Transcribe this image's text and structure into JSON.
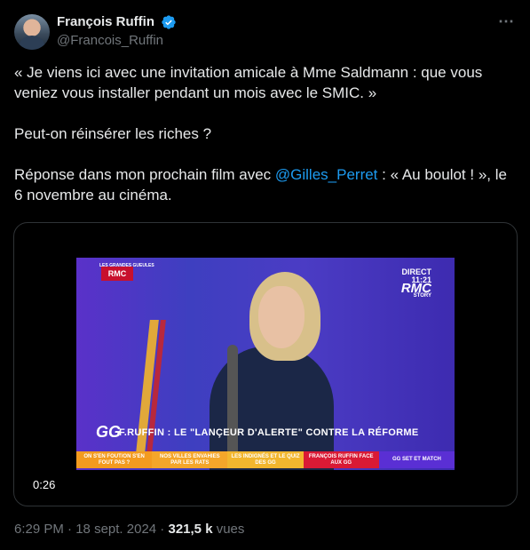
{
  "author": {
    "name": "François Ruffin",
    "handle": "@Francois_Ruffin",
    "verified_color": "#1d9bf0"
  },
  "more_icon": "⋯",
  "tweet": {
    "line1": "« Je viens ici avec une invitation amicale à Mme Saldmann : que vous veniez vous installer pendant un mois avec le SMIC. »",
    "line2": "Peut-on réinsérer les riches ?",
    "line3_before": "Réponse dans mon prochain film avec ",
    "line3_mention": "@Gilles_Perret",
    "line3_after": " : « Au boulot ! », le 6 novembre au cinéma."
  },
  "video": {
    "duration": "0:26",
    "logo_left": "RMC",
    "logo_left_small": "LES GRANDES GUEULES",
    "logo_direct": "DIRECT",
    "logo_time": "11:21",
    "logo_rmc": "RMC",
    "logo_story": "STORY",
    "badge": "GG",
    "banner": "F.RUFFIN : LE \"LANÇEUR D'ALERTE\" CONTRE LA RÉFORME",
    "ticker": [
      "ON S'EN FOUT/ON S'EN FOUT PAS ?",
      "NOS VILLES ENVAHIES PAR LES RATS",
      "LES INDIGNÉS ET LE QUIZ DES GG",
      "FRANÇOIS RUFFIN FACE AUX GG",
      "GG SET ET MATCH"
    ]
  },
  "meta": {
    "time": "6:29 PM",
    "sep1": " · ",
    "date": "18 sept. 2024",
    "sep2": " · ",
    "views_count": "321,5 k",
    "views_label": " vues"
  }
}
